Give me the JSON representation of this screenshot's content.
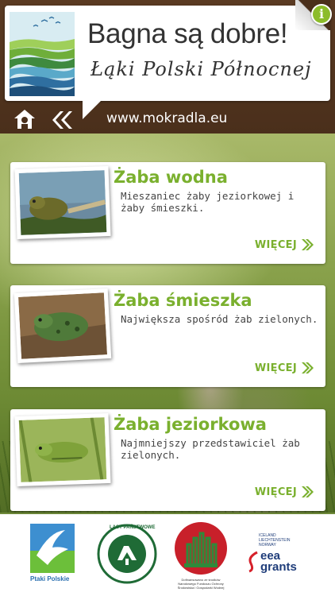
{
  "header": {
    "title": "Bagna są dobre!",
    "subtitle": "Łąki Polski Północnej",
    "url": "www.mokradla.eu",
    "info_icon_text": "i",
    "icons": {
      "home": "home-icon",
      "back": "back-chevrons-icon",
      "info": "info-icon",
      "logo": "wetland-landscape-logo"
    }
  },
  "species": [
    {
      "name": "Żaba wodna",
      "description": "Mieszaniec żaby jeziorkowej i żaby śmieszki.",
      "more_label": "WIĘCEJ"
    },
    {
      "name": "Żaba śmieszka",
      "description": "Największa spośród żab zielonych.",
      "more_label": "WIĘCEJ"
    },
    {
      "name": "Żaba jeziorkowa",
      "description": "Najmniejszy przedstawiciel żab zielonych.",
      "more_label": "WIĘCEJ"
    }
  ],
  "sponsors": {
    "ptaki": "Ptaki Polskie",
    "lasy": "LASY PAŃSTWOWE",
    "nfos": "Dofinansowano ze środków Narodowego Funduszu Ochrony Środowiska i Gospodarki Wodnej",
    "eea_countries": [
      "ICELAND",
      "LIECHTENSTEIN",
      "NORWAY"
    ],
    "eea_word1": "eea",
    "eea_word2": "grants"
  },
  "colors": {
    "accent": "#7ab02e",
    "header_bg": "#4a2f1b",
    "info_green": "#8cbc2a"
  }
}
